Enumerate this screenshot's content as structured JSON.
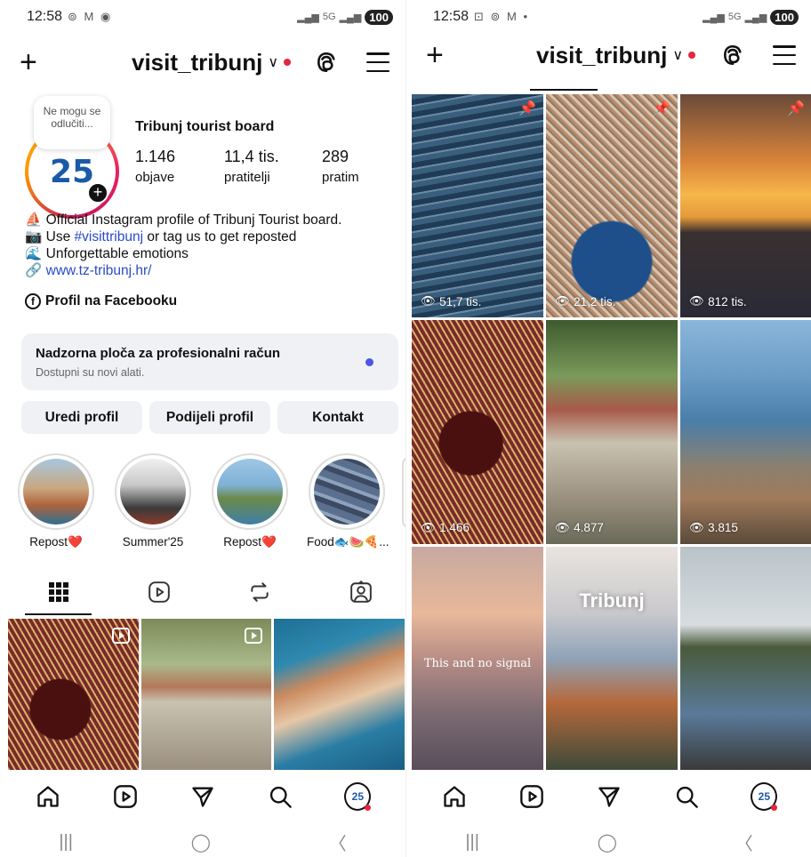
{
  "left": {
    "status": {
      "time": "12:58",
      "icons": "⊚ M ◉",
      "signal": "5G",
      "battery": "100"
    },
    "header": {
      "username": "visit_tribunj"
    },
    "note": {
      "text": "Ne mogu se odlučiti..."
    },
    "profile": {
      "full_name": "Tribunj tourist board",
      "stats": [
        {
          "value": "1.146",
          "label": "objave"
        },
        {
          "value": "11,4 tis.",
          "label": "pratitelji"
        },
        {
          "value": "289",
          "label": "pratim"
        }
      ],
      "bio_line1": "Official Instagram profile of Tribunj Tourist board.",
      "bio_line2_pre": "Use ",
      "bio_hashtag": "#visittribunj",
      "bio_line2_post": " or tag us to get reposted",
      "bio_line3": "Unforgettable emotions",
      "bio_link": "www.tz-tribunj.hr/",
      "facebook": "Profil na Facebooku"
    },
    "dashboard": {
      "title": "Nadzorna ploča za profesionalni račun",
      "subtitle": "Dostupni su novi alati."
    },
    "buttons": {
      "edit": "Uredi profil",
      "share": "Podijeli profil",
      "contact": "Kontakt"
    },
    "highlights": [
      {
        "label": "Repost❤️"
      },
      {
        "label": "Summer'25"
      },
      {
        "label": "Repost❤️"
      },
      {
        "label": "Food🐟🍉🍕..."
      }
    ]
  },
  "right": {
    "status": {
      "time": "12:58",
      "icons": "⊡ ⊚ M •",
      "signal": "5G",
      "battery": "100"
    },
    "header": {
      "username": "visit_tribunj"
    },
    "grid": [
      {
        "views": "51,7 tis.",
        "pinned": true
      },
      {
        "views": "21,2 tis.",
        "pinned": true
      },
      {
        "views": "812 tis.",
        "pinned": true
      },
      {
        "views": "1.466",
        "pinned": false
      },
      {
        "views": "4.877",
        "pinned": false
      },
      {
        "views": "3.815",
        "pinned": false
      },
      {
        "views": "",
        "pinned": false,
        "overlay": "This and no signal"
      },
      {
        "views": "",
        "pinned": false,
        "overlay": "Tribunj"
      },
      {
        "views": "",
        "pinned": false
      }
    ]
  },
  "colors": {
    "accent": "#e5263d",
    "link": "#2a4bc7",
    "button_bg": "#eff1f4"
  }
}
